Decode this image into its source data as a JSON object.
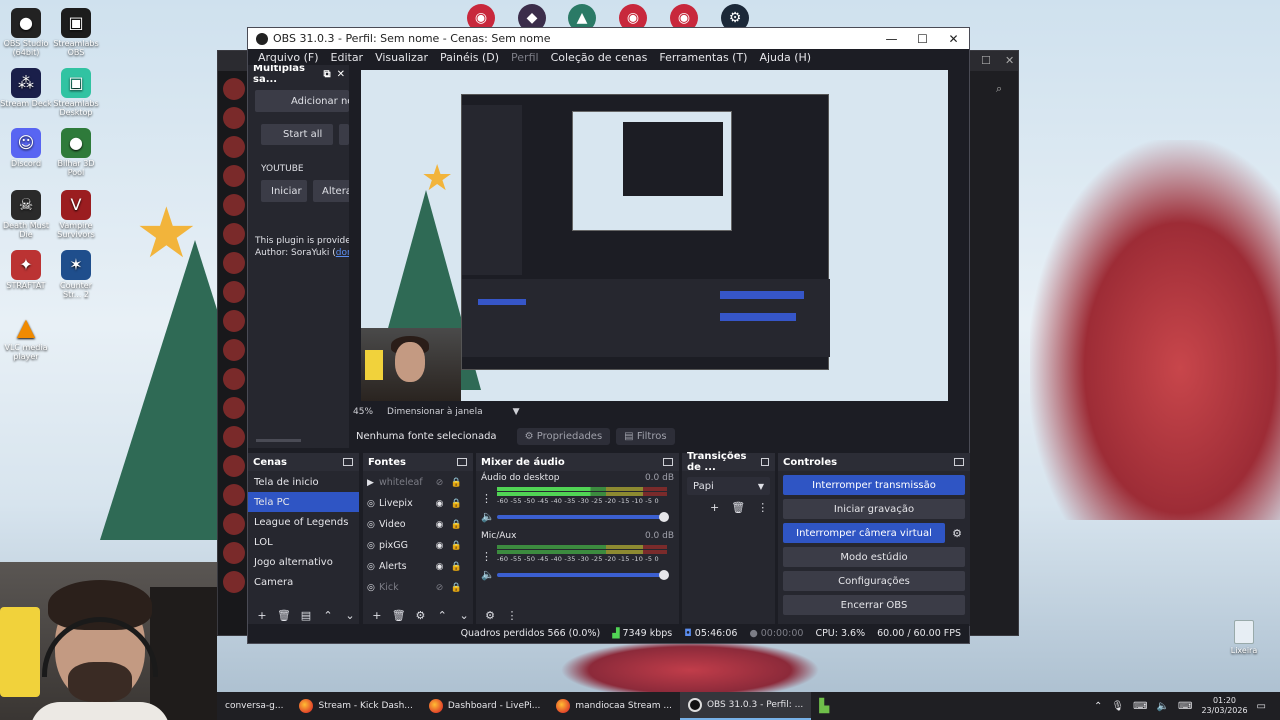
{
  "desktop": {
    "icons": [
      {
        "label": "OBS Studio (64bit)",
        "icon": "obs-icon",
        "color": "#222222"
      },
      {
        "label": "Streamlabs OBS",
        "icon": "streamlabs-obs-icon",
        "color": "#1c1c1c"
      },
      {
        "label": "Stream Deck",
        "icon": "stream-deck-icon",
        "color": "#1a1f4a"
      },
      {
        "label": "Streamlabs Desktop",
        "icon": "streamlabs-desktop-icon",
        "color": "#31c3a2"
      },
      {
        "label": "Discord",
        "icon": "discord-icon",
        "color": "#5865f2"
      },
      {
        "label": "Bilhar 3D Pool",
        "icon": "pool-icon",
        "color": "#2e7a3a"
      },
      {
        "label": "Death Must Die",
        "icon": "death-must-die-icon",
        "color": "#2a2a2a"
      },
      {
        "label": "Vampire Survivors",
        "icon": "vampire-survivors-icon",
        "color": "#9b1d20"
      },
      {
        "label": "STRAFTAT",
        "icon": "straftat-icon",
        "color": "#b33"
      },
      {
        "label": "Counter Str... 2",
        "icon": "counter-strike-icon",
        "color": "#1f4e8c"
      },
      {
        "label": "VLC media player",
        "icon": "vlc-icon",
        "color": "#f08a00"
      }
    ],
    "recycle_bin": "Lixeira"
  },
  "obs": {
    "title": "OBS 31.0.3 - Perfil: Sem nome - Cenas: Sem nome",
    "menu": [
      "Arquivo (F)",
      "Editar",
      "Visualizar",
      "Painéis (D)",
      "Perfil",
      "Coleção de cenas",
      "Ferramentas (T)",
      "Ajuda (H)"
    ],
    "plugin_dock": {
      "title": "Multiplas sa...",
      "add_button": "Adicionar nov",
      "start_all": "Start all",
      "youtube_label": "YOUTUBE",
      "start_button": "Iniciar",
      "edit_button": "Altera",
      "info_text": "This plugin is provided",
      "author_text": "Author: SoraYuki (",
      "author_link": "dona"
    },
    "zoom": "45%",
    "resize_label": "Dimensionar à janela",
    "no_source": "Nenhuma fonte selecionada",
    "properties": "Propriedades",
    "filters": "Filtros",
    "scenes": {
      "title": "Cenas",
      "items": [
        "Tela de inicio",
        "Tela PC",
        "League of Legends",
        "LOL",
        "Jogo alternativo",
        "Camera"
      ],
      "selected": "Tela PC"
    },
    "sources": {
      "title": "Fontes",
      "items": [
        {
          "name": "whiteleaf",
          "icon": "play-icon",
          "visible": false
        },
        {
          "name": "Livepix",
          "icon": "globe-icon",
          "visible": true
        },
        {
          "name": "Video",
          "icon": "globe-icon",
          "visible": true
        },
        {
          "name": "pixGG",
          "icon": "globe-icon",
          "visible": true
        },
        {
          "name": "Alerts",
          "icon": "globe-icon",
          "visible": true
        },
        {
          "name": "Kick",
          "icon": "globe-icon",
          "visible": false
        }
      ]
    },
    "mixer": {
      "title": "Mixer de áudio",
      "scale": "-60 -55 -50 -45 -40 -35 -30 -25 -20 -15 -10 -5 0",
      "tracks": [
        {
          "name": "Áudio do desktop",
          "db": "0.0 dB"
        },
        {
          "name": "Mic/Aux",
          "db": "0.0 dB"
        }
      ]
    },
    "transitions": {
      "title": "Transições de ...",
      "selected": "Papi"
    },
    "controls": {
      "title": "Controles",
      "stop_stream": "Interromper transmissão",
      "start_recording": "Iniciar gravação",
      "stop_virtual_cam": "Interromper câmera virtual",
      "studio_mode": "Modo estúdio",
      "settings": "Configurações",
      "exit": "Encerrar OBS"
    },
    "status": {
      "dropped_frames": "Quadros perdidos 566 (0.0%)",
      "bitrate": "7349 kbps",
      "stream_time": "05:46:06",
      "rec_time": "00:00:00",
      "cpu": "CPU: 3.6%",
      "fps": "60.00 / 60.00 FPS"
    }
  },
  "taskbar": {
    "tasks": [
      {
        "label": "conversa-g...",
        "icon": "",
        "active": false
      },
      {
        "label": "Stream - Kick Dash...",
        "icon": "firefox-icon",
        "active": false
      },
      {
        "label": "Dashboard - LivePi...",
        "icon": "firefox-icon",
        "active": false
      },
      {
        "label": "mandiocaa Stream ...",
        "icon": "firefox-icon",
        "active": false
      },
      {
        "label": "OBS 31.0.3 - Perfil: ...",
        "icon": "obs-icon",
        "active": true
      }
    ],
    "time": "01:20",
    "date": "23/03/2026"
  },
  "colors": {
    "accent_blue": "#2f55c4",
    "panel_bg": "#26272f",
    "window_bg": "#1c1d24"
  }
}
